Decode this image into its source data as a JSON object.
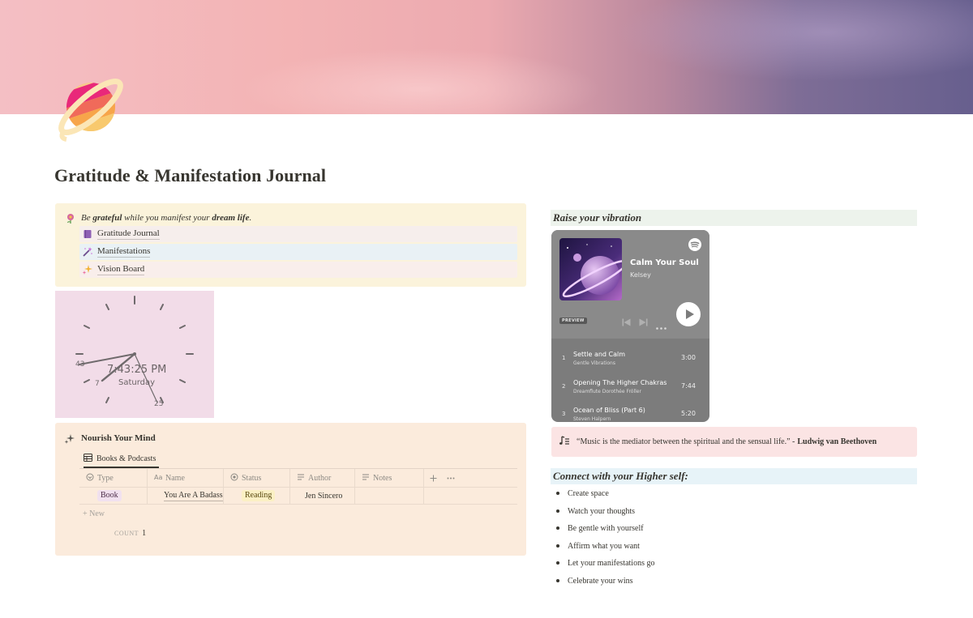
{
  "page": {
    "title": "Gratitude & Manifestation Journal",
    "icon": "saturn-planet-icon"
  },
  "callout": {
    "icon": "flower-icon",
    "text_prefix": "Be ",
    "text_grateful": "grateful",
    "text_middle": " while you manifest your ",
    "text_dream": "dream life",
    "text_suffix": ".",
    "links": [
      {
        "label": "Gratitude Journal",
        "icon": "book-icon",
        "bg": "#f6eeec"
      },
      {
        "label": "Manifestations",
        "icon": "magic-wand-icon",
        "bg": "#e9f1f5"
      },
      {
        "label": "Vision Board",
        "icon": "sparkles-icon",
        "bg": "#f9eeeb"
      }
    ]
  },
  "clock": {
    "time": "7:43:25 PM",
    "day": "Saturday",
    "minute_label": "43",
    "hour_label": "7",
    "second_label": "25"
  },
  "nourish": {
    "title": "Nourish Your Mind",
    "tab_label": "Books & Podcasts",
    "columns": [
      "Type",
      "Name",
      "Status",
      "Author",
      "Notes"
    ],
    "rows": [
      {
        "type": "Book",
        "name": "You Are A Badass",
        "status": "Reading",
        "author": "Jen Sincero",
        "notes": ""
      }
    ],
    "new_label": "New",
    "count_label": "COUNT",
    "count_value": "1"
  },
  "vibration": {
    "heading": "Raise your vibration",
    "player": {
      "title": "Calm Your Soul",
      "artist": "Kelsey",
      "preview_label": "PREVIEW",
      "tracks": [
        {
          "num": "1",
          "title": "Settle and Calm",
          "artist": "Gentle Vibrations",
          "duration": "3:00"
        },
        {
          "num": "2",
          "title": "Opening The Higher Chakras",
          "artist": "Dreamflute Dorothée Fröller",
          "duration": "7:44"
        },
        {
          "num": "3",
          "title": "Ocean of Bliss (Part 6)",
          "artist": "Steven Halpern",
          "duration": "5:20"
        }
      ]
    }
  },
  "quote": {
    "text": "“Music is the mediator between the spiritual and the sensual life.” - ",
    "author": "Ludwig van Beethoven"
  },
  "higher_self": {
    "heading": "Connect with your Higher self:",
    "items": [
      "Create space",
      "Watch your thoughts",
      "Be gentle with yourself",
      "Affirm what you want",
      "Let your manifestations go",
      "Celebrate your wins"
    ]
  }
}
